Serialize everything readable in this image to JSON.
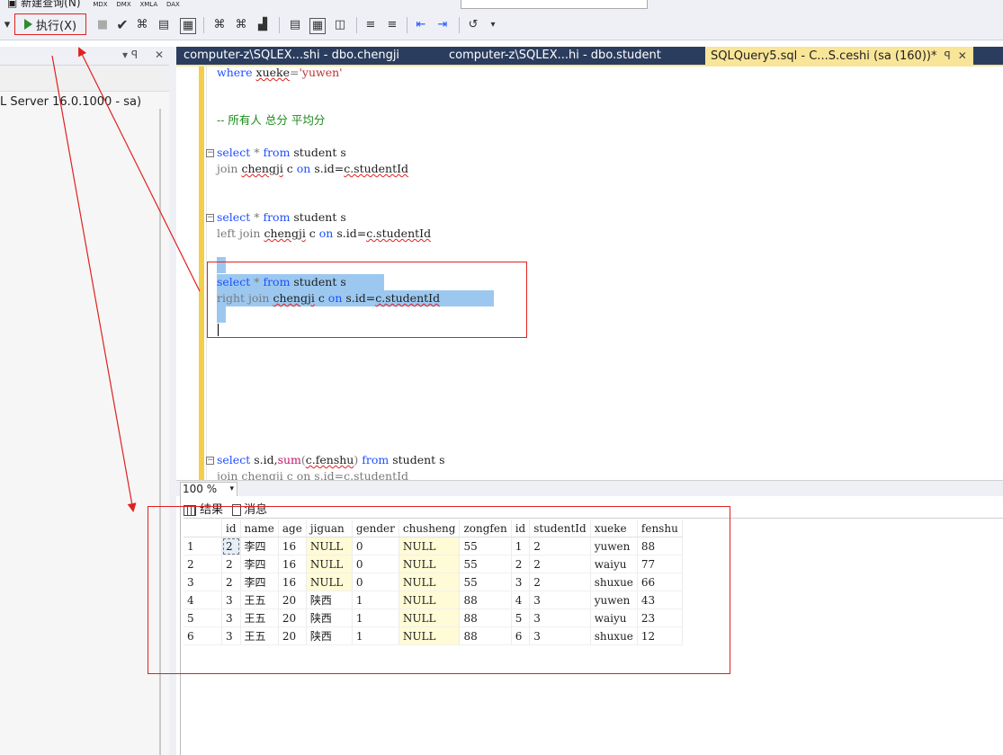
{
  "toolbar": {
    "new_query_label": "新建查询(N)",
    "execute_label": "执行(X)",
    "top_icons": [
      "MDX",
      "DMX",
      "XMLA",
      "DAX"
    ]
  },
  "object_explorer": {
    "server_label": "L Server 16.0.1000 - sa)",
    "pin": "▾ ꟼ",
    "close": "✕"
  },
  "tabs": [
    {
      "label": "computer-z\\SQLEX...shi - dbo.chengji"
    },
    {
      "label": "computer-z\\SQLEX...hi - dbo.student"
    },
    {
      "label": "SQLQuery5.sql - C...S.ceshi (sa (160))*",
      "active": true,
      "pin": "ꟼ",
      "close": "✕"
    }
  ],
  "editor": {
    "lines": {
      "l1_kw": "where",
      "l1_col": "xueke",
      "l1_op": "=",
      "l1_str": "'yuwen'",
      "comment": "-- 所有人 总分 平均分",
      "q1a_kw1": "select",
      "q1a_mid": " * ",
      "q1a_kw2": "from",
      "q1a_rest": " student s",
      "q1b_kw1": "join",
      "q1b_t": "chengji",
      "q1b_mid": " c ",
      "q1b_kw2": "on",
      "q1b_rest1": " s.id=",
      "q1b_sq": "c.studentId",
      "q2a_kw1": "select",
      "q2a_mid": " * ",
      "q2a_kw2": "from",
      "q2a_rest": " student s",
      "q2b_kw1": "left join",
      "q2b_t": "chengji",
      "q2b_mid": " c ",
      "q2b_kw2": "on",
      "q2b_rest1": " s.id=",
      "q2b_sq": "c.studentId",
      "q3a_kw1": "select",
      "q3a_mid": " * ",
      "q3a_kw2": "from",
      "q3a_rest": " student s",
      "q3b_kw1": "right join",
      "q3b_t": "chengji",
      "q3b_mid": " c ",
      "q3b_kw2": "on",
      "q3b_rest1": " s.id=",
      "q3b_sq": "c.studentId",
      "q4a_kw1": "select",
      "q4a_mid": " s.id,",
      "q4a_fn": "sum",
      "q4a_p1": "(",
      "q4a_sq": "c.fenshu",
      "q4a_p2": ")",
      "q4a_kw2": "from",
      "q4a_rest": " student s",
      "q4b_text": "join chengji c on s.id=c.studentId"
    }
  },
  "zoom": "100 %",
  "results": {
    "tab_results": "结果",
    "tab_messages": "消息",
    "columns": [
      "",
      "id",
      "name",
      "age",
      "jiguan",
      "gender",
      "chusheng",
      "zongfen",
      "id",
      "studentId",
      "xueke",
      "fenshu"
    ],
    "rows": [
      [
        "1",
        "2",
        "李四",
        "16",
        "NULL",
        "0",
        "NULL",
        "55",
        "1",
        "2",
        "yuwen",
        "88"
      ],
      [
        "2",
        "2",
        "李四",
        "16",
        "NULL",
        "0",
        "NULL",
        "55",
        "2",
        "2",
        "waiyu",
        "77"
      ],
      [
        "3",
        "2",
        "李四",
        "16",
        "NULL",
        "0",
        "NULL",
        "55",
        "3",
        "2",
        "shuxue",
        "66"
      ],
      [
        "4",
        "3",
        "王五",
        "20",
        "陕西",
        "1",
        "NULL",
        "88",
        "4",
        "3",
        "yuwen",
        "43"
      ],
      [
        "5",
        "3",
        "王五",
        "20",
        "陕西",
        "1",
        "NULL",
        "88",
        "5",
        "3",
        "waiyu",
        "23"
      ],
      [
        "6",
        "3",
        "王五",
        "20",
        "陕西",
        "1",
        "NULL",
        "88",
        "6",
        "3",
        "shuxue",
        "12"
      ]
    ]
  }
}
